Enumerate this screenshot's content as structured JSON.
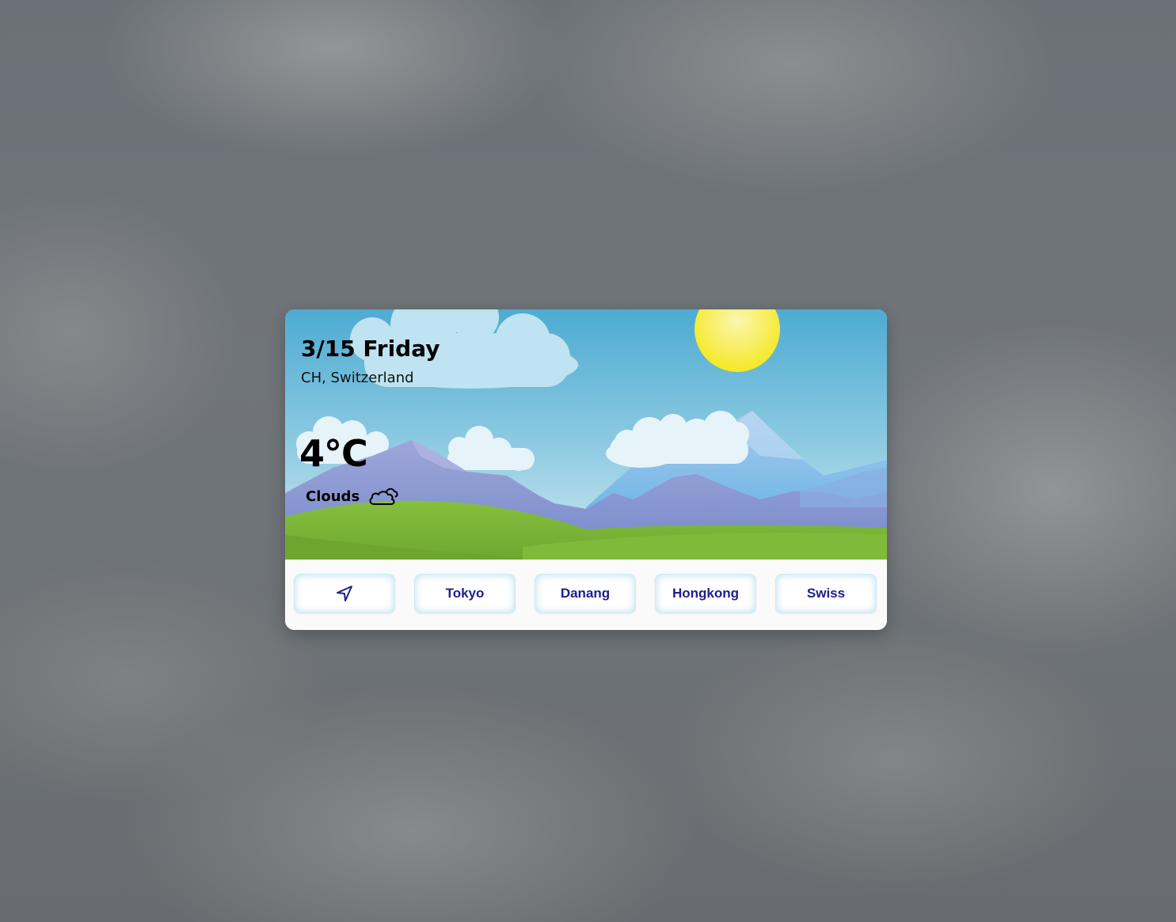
{
  "weather": {
    "date": "3/15 Friday",
    "location": "CH, Switzerland",
    "temperature": "4°C",
    "condition": "Clouds",
    "condition_icon": "cloud-icon"
  },
  "cities": [
    {
      "label": "",
      "icon": "location-arrow-icon"
    },
    {
      "label": "Tokyo"
    },
    {
      "label": "Danang"
    },
    {
      "label": "Hongkong"
    },
    {
      "label": "Swiss"
    }
  ],
  "colors": {
    "button_text": "#1d1f8c",
    "sky_top": "#4eacd3",
    "sun": "#f7ea2e",
    "grass": "#7ab53a"
  }
}
